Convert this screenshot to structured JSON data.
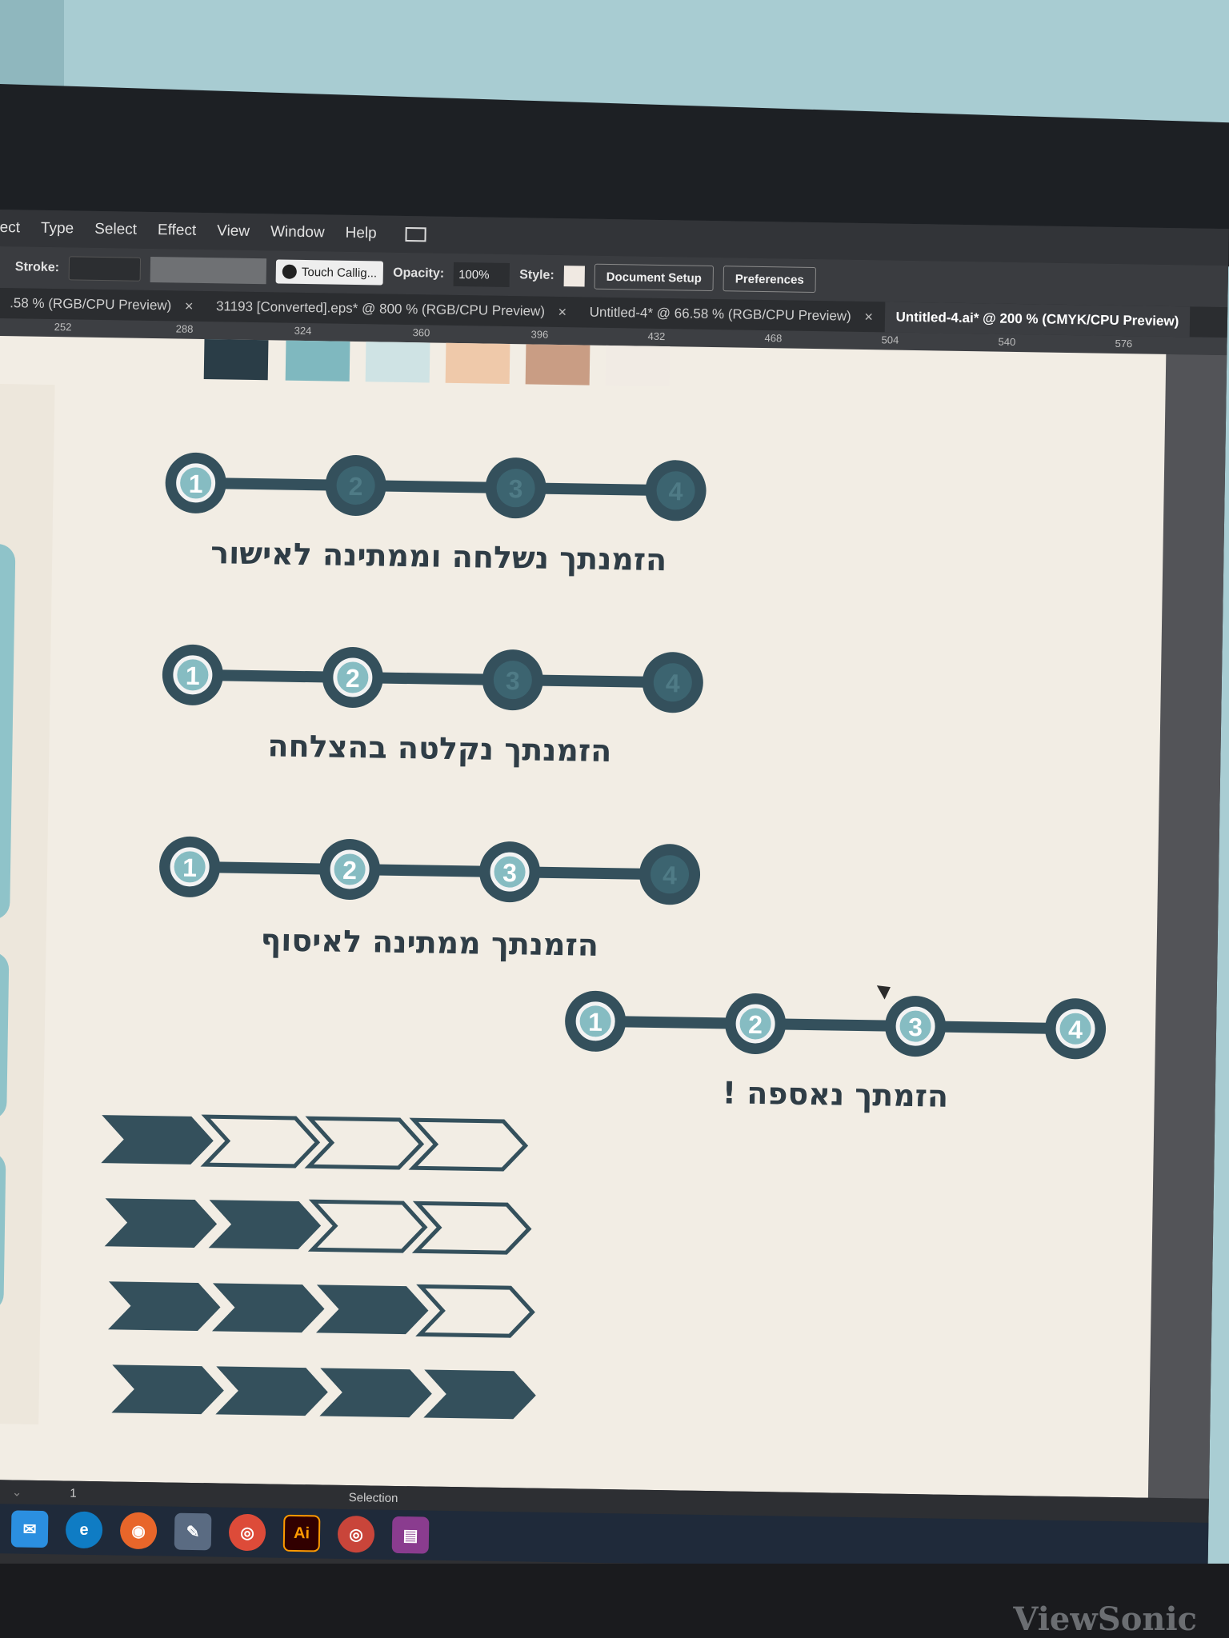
{
  "menu": {
    "items": [
      "ect",
      "Type",
      "Select",
      "Effect",
      "View",
      "Window",
      "Help"
    ]
  },
  "control_bar": {
    "stroke_label": "Stroke:",
    "brush_name": "Touch Callig...",
    "opacity_label": "Opacity:",
    "opacity_value": "100%",
    "style_label": "Style:",
    "document_setup": "Document Setup",
    "preferences": "Preferences"
  },
  "tabs": [
    {
      "label": ".58 % (RGB/CPU Preview)"
    },
    {
      "label": "31193 [Converted].eps* @ 800 % (RGB/CPU Preview)"
    },
    {
      "label": "Untitled-4* @ 66.58 % (RGB/CPU Preview)"
    },
    {
      "label": "Untitled-4.ai* @ 200 % (CMYK/CPU Preview)"
    }
  ],
  "ruler": {
    "ticks": [
      "252",
      "288",
      "324",
      "360",
      "396",
      "432",
      "468",
      "504",
      "540",
      "576"
    ]
  },
  "palette": {
    "colors": [
      "#2a3d47",
      "#7fb8bf",
      "#cfe3e4",
      "#efc9aa",
      "#c99d84",
      "#f1ebe4"
    ]
  },
  "steps": [
    {
      "numbers": [
        "1",
        "2",
        "3",
        "4"
      ],
      "active": 1,
      "caption": "הזמנתך נשלחה וממתינה לאישור"
    },
    {
      "numbers": [
        "1",
        "2",
        "3",
        "4"
      ],
      "active": 2,
      "caption": "הזמנתך נקלטה בהצלחה"
    },
    {
      "numbers": [
        "1",
        "2",
        "3",
        "4"
      ],
      "active": 3,
      "caption": "הזמנתך ממתינה לאיסוף"
    },
    {
      "numbers": [
        "1",
        "2",
        "3",
        "4"
      ],
      "active": 4,
      "caption": "הזמתך נאספה !"
    }
  ],
  "chevron_rows": [
    {
      "filled": 1,
      "total": 4
    },
    {
      "filled": 2,
      "total": 4
    },
    {
      "filled": 3,
      "total": 4
    },
    {
      "filled": 4,
      "total": 4
    }
  ],
  "status_bar": {
    "page": "1",
    "tool": "Selection"
  },
  "taskbar": {
    "apps": [
      "mail-icon",
      "edge-icon",
      "firefox-icon",
      "paint-icon",
      "chrome-icon",
      "illustrator-icon",
      "chrome-profile-icon",
      "winrar-icon"
    ],
    "illustrator_label": "Ai"
  },
  "monitor_brand": "ViewSonic",
  "colors": {
    "dark": "#34505c",
    "teal": "#86bcc2",
    "dim_teal": "#3c6470",
    "artboard": "#f2ede4"
  }
}
